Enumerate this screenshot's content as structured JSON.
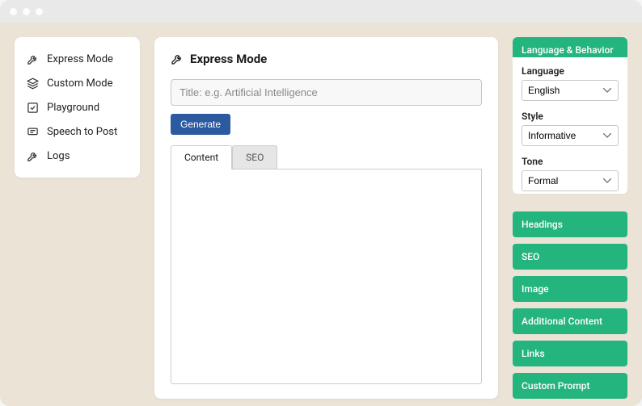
{
  "colors": {
    "accent": "#24b47e",
    "primary_button": "#2c5aa0"
  },
  "sidebar": {
    "items": [
      {
        "label": "Express Mode",
        "icon": "wrench-icon"
      },
      {
        "label": "Custom Mode",
        "icon": "layers-icon"
      },
      {
        "label": "Playground",
        "icon": "check-square-icon"
      },
      {
        "label": "Speech to Post",
        "icon": "speech-icon"
      },
      {
        "label": "Logs",
        "icon": "wrench-icon"
      }
    ]
  },
  "main": {
    "title": "Express Mode",
    "title_icon": "wrench-icon",
    "title_input": {
      "value": "",
      "placeholder": "Title: e.g. Artificial Intelligence"
    },
    "generate_label": "Generate",
    "tabs": [
      {
        "label": "Content",
        "active": true
      },
      {
        "label": "SEO",
        "active": false
      }
    ],
    "editor_value": ""
  },
  "rightbar": {
    "panel_expanded": {
      "title": "Language & Behavior",
      "fields": [
        {
          "label": "Language",
          "value": "English"
        },
        {
          "label": "Style",
          "value": "Informative"
        },
        {
          "label": "Tone",
          "value": "Formal"
        }
      ]
    },
    "panels_collapsed": [
      {
        "title": "Headings"
      },
      {
        "title": "SEO"
      },
      {
        "title": "Image"
      },
      {
        "title": "Additional Content"
      },
      {
        "title": "Links"
      },
      {
        "title": "Custom Prompt"
      }
    ]
  }
}
